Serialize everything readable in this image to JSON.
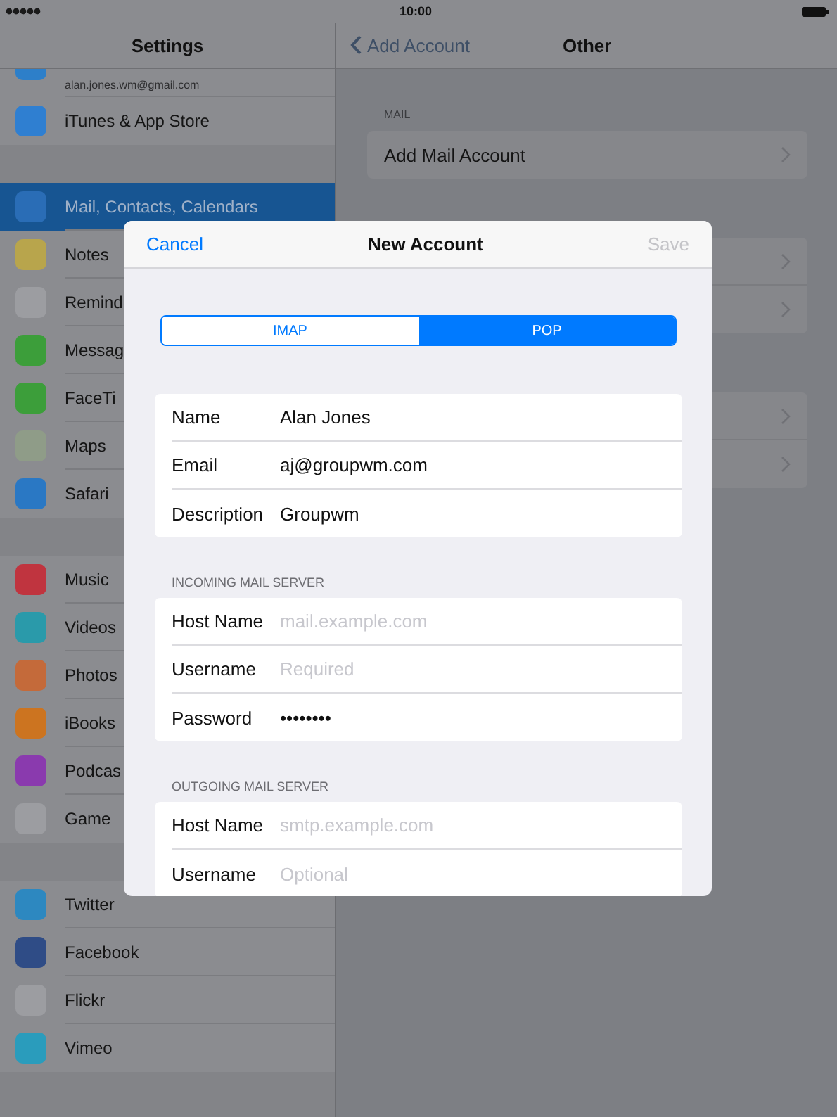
{
  "status_bar": {
    "time": "10:00"
  },
  "sidebar": {
    "title": "Settings",
    "groups": [
      {
        "items": [
          {
            "kind": "partial",
            "label": "alan.jones.wm@gmail.com",
            "color": "#2d7fc9",
            "selected": false
          },
          {
            "kind": "app",
            "label": "iTunes & App Store",
            "color": "#2f7fd1",
            "selected": false
          }
        ]
      },
      {
        "items": [
          {
            "kind": "app",
            "label": "Mail, Contacts, Calendars",
            "color": "#2a6db6",
            "selected": true
          },
          {
            "kind": "app",
            "label": "Notes",
            "color": "#b8a54c",
            "selected": false
          },
          {
            "kind": "app",
            "label": "Remind",
            "color": "#9c9da1",
            "selected": false
          },
          {
            "kind": "app",
            "label": "Messag",
            "color": "#3c9e3a",
            "selected": false
          },
          {
            "kind": "app",
            "label": "FaceTi",
            "color": "#3c9e3a",
            "selected": false
          },
          {
            "kind": "app",
            "label": "Maps",
            "color": "#8f9c88",
            "selected": false
          },
          {
            "kind": "app",
            "label": "Safari",
            "color": "#2a78c4",
            "selected": false
          }
        ]
      },
      {
        "items": [
          {
            "kind": "app",
            "label": "Music",
            "color": "#c0343f",
            "selected": false
          },
          {
            "kind": "app",
            "label": "Videos",
            "color": "#2a9aaa",
            "selected": false
          },
          {
            "kind": "app",
            "label": "Photos",
            "color": "#c46a3a",
            "selected": false
          },
          {
            "kind": "app",
            "label": "iBooks",
            "color": "#cc7420",
            "selected": false
          },
          {
            "kind": "app",
            "label": "Podcas",
            "color": "#8a3aae",
            "selected": false
          },
          {
            "kind": "app",
            "label": "Game",
            "color": "#9c9da1",
            "selected": false
          }
        ]
      },
      {
        "items": [
          {
            "kind": "app",
            "label": "Twitter",
            "color": "#2d88c0",
            "selected": false
          },
          {
            "kind": "app",
            "label": "Facebook",
            "color": "#2f4c86",
            "selected": false
          },
          {
            "kind": "app",
            "label": "Flickr",
            "color": "#9c9da1",
            "selected": false
          },
          {
            "kind": "app",
            "label": "Vimeo",
            "color": "#2a9cbc",
            "selected": false
          }
        ]
      }
    ]
  },
  "detail": {
    "back": "Add Account",
    "title": "Other",
    "groups": [
      {
        "header": "MAIL",
        "rows": [
          {
            "kind": "link",
            "label": "Add Mail Account"
          }
        ]
      },
      {
        "rows": [
          {
            "kind": "link"
          },
          {
            "kind": "link"
          }
        ]
      },
      {
        "rows": [
          {
            "kind": "link"
          },
          {
            "kind": "link"
          }
        ]
      }
    ]
  },
  "dialog": {
    "title": "New Account",
    "cancel": "Cancel",
    "save": {
      "label": "Save",
      "disabled": true
    },
    "segments": [
      {
        "label": "IMAP",
        "selected": false
      },
      {
        "label": "POP",
        "selected": true
      }
    ],
    "sections": [
      {
        "fields": [
          {
            "label": "Name",
            "value": "Alan Jones"
          },
          {
            "label": "Email",
            "value": "aj@groupwm.com"
          },
          {
            "label": "Description",
            "value": "Groupwm"
          }
        ]
      },
      {
        "header": "INCOMING MAIL SERVER",
        "fields": [
          {
            "label": "Host Name",
            "placeholder": "mail.example.com"
          },
          {
            "label": "Username",
            "placeholder": "Required"
          },
          {
            "label": "Password",
            "value": "••••••••"
          }
        ]
      },
      {
        "header": "OUTGOING MAIL SERVER",
        "fields": [
          {
            "label": "Host Name",
            "placeholder": "smtp.example.com"
          },
          {
            "label": "Username",
            "placeholder": "Optional"
          }
        ]
      }
    ]
  }
}
